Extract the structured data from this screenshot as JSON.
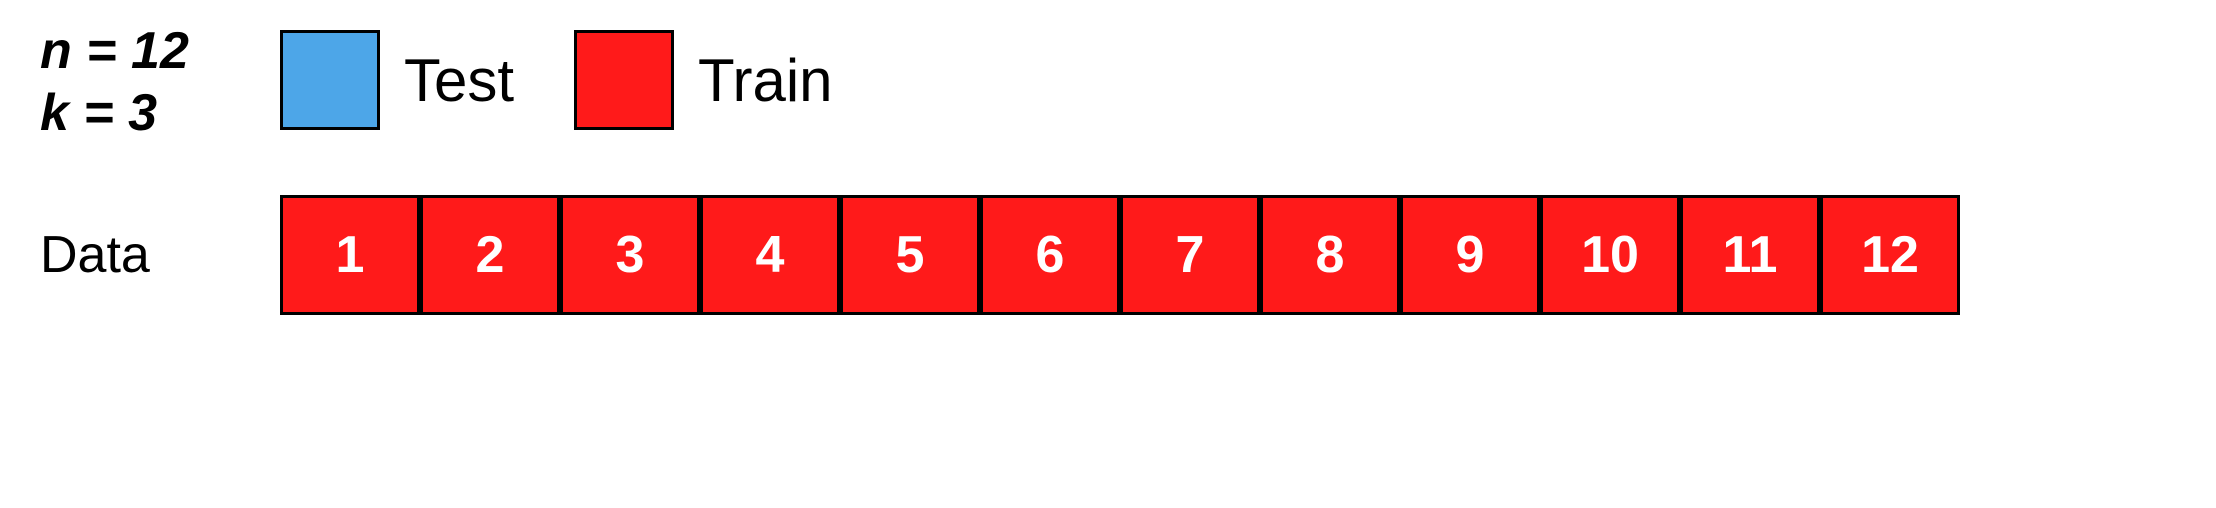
{
  "stats": {
    "n_label": "n = 12",
    "k_label": "k = 3"
  },
  "legend": {
    "test_label": "Test",
    "train_label": "Train",
    "test_color": "#4da6e8",
    "train_color": "#ff1a1a",
    "border_color": "#000000"
  },
  "data_section": {
    "label": "Data",
    "cells": [
      {
        "value": "1"
      },
      {
        "value": "2"
      },
      {
        "value": "3"
      },
      {
        "value": "4"
      },
      {
        "value": "5"
      },
      {
        "value": "6"
      },
      {
        "value": "7"
      },
      {
        "value": "8"
      },
      {
        "value": "9"
      },
      {
        "value": "10"
      },
      {
        "value": "11"
      },
      {
        "value": "12"
      }
    ]
  }
}
